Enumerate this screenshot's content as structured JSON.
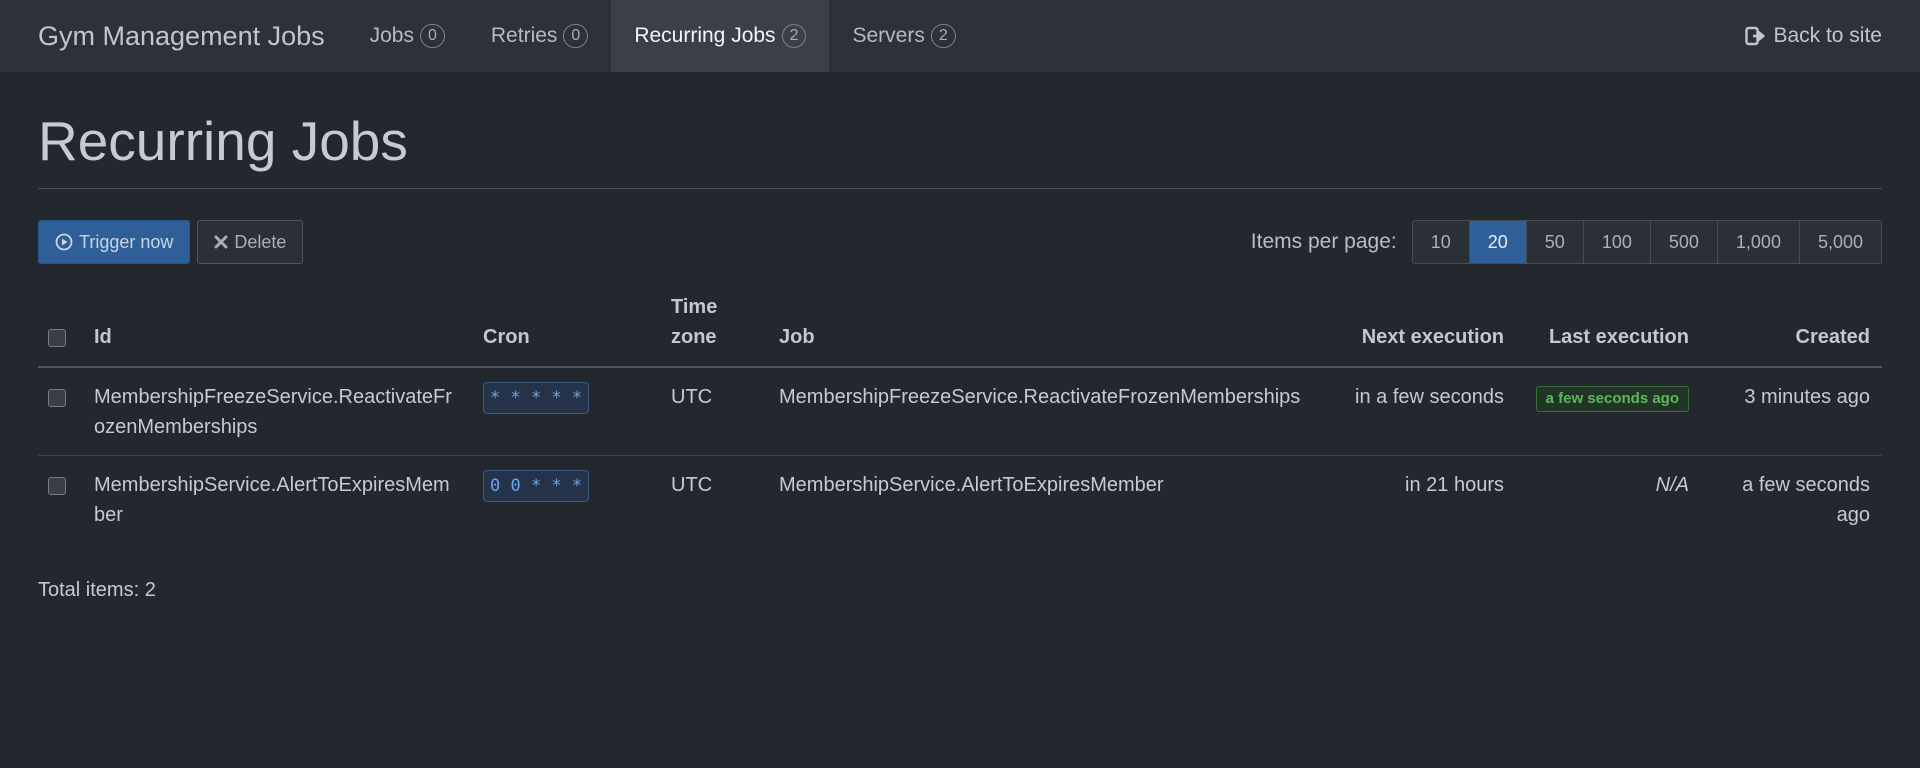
{
  "navbar": {
    "brand": "Gym Management Jobs",
    "items": [
      {
        "label": "Jobs",
        "count": "0"
      },
      {
        "label": "Retries",
        "count": "0"
      },
      {
        "label": "Recurring Jobs",
        "count": "2"
      },
      {
        "label": "Servers",
        "count": "2"
      }
    ],
    "back_label": "Back to site"
  },
  "page": {
    "title": "Recurring Jobs"
  },
  "toolbar": {
    "trigger_label": "Trigger now",
    "delete_label": "Delete",
    "per_page_label": "Items per page:",
    "per_page_options": [
      "10",
      "20",
      "50",
      "100",
      "500",
      "1,000",
      "5,000"
    ],
    "per_page_selected": "20"
  },
  "table": {
    "headers": {
      "id": "Id",
      "cron": "Cron",
      "timezone": "Time zone",
      "job": "Job",
      "next": "Next execution",
      "last": "Last execution",
      "created": "Created"
    },
    "rows": [
      {
        "id": "MembershipFreezeService.ReactivateFrozenMemberships",
        "cron": "* * * * *",
        "timezone": "UTC",
        "job": "MembershipFreezeService.ReactivateFrozenMemberships",
        "next": "in a few seconds",
        "last": "a few seconds ago",
        "created": "3 minutes ago"
      },
      {
        "id": "MembershipService.AlertToExpiresMember",
        "cron": "0 0 * * *",
        "timezone": "UTC",
        "job": "MembershipService.AlertToExpiresMember",
        "next": "in 21 hours",
        "last": "N/A",
        "created": "a few seconds ago"
      }
    ]
  },
  "footer": {
    "total": "Total items: 2"
  },
  "colors": {
    "background": "#23272e",
    "navbar": "#2d3139",
    "primary": "#2e5f98",
    "success": "#5cb85c"
  }
}
